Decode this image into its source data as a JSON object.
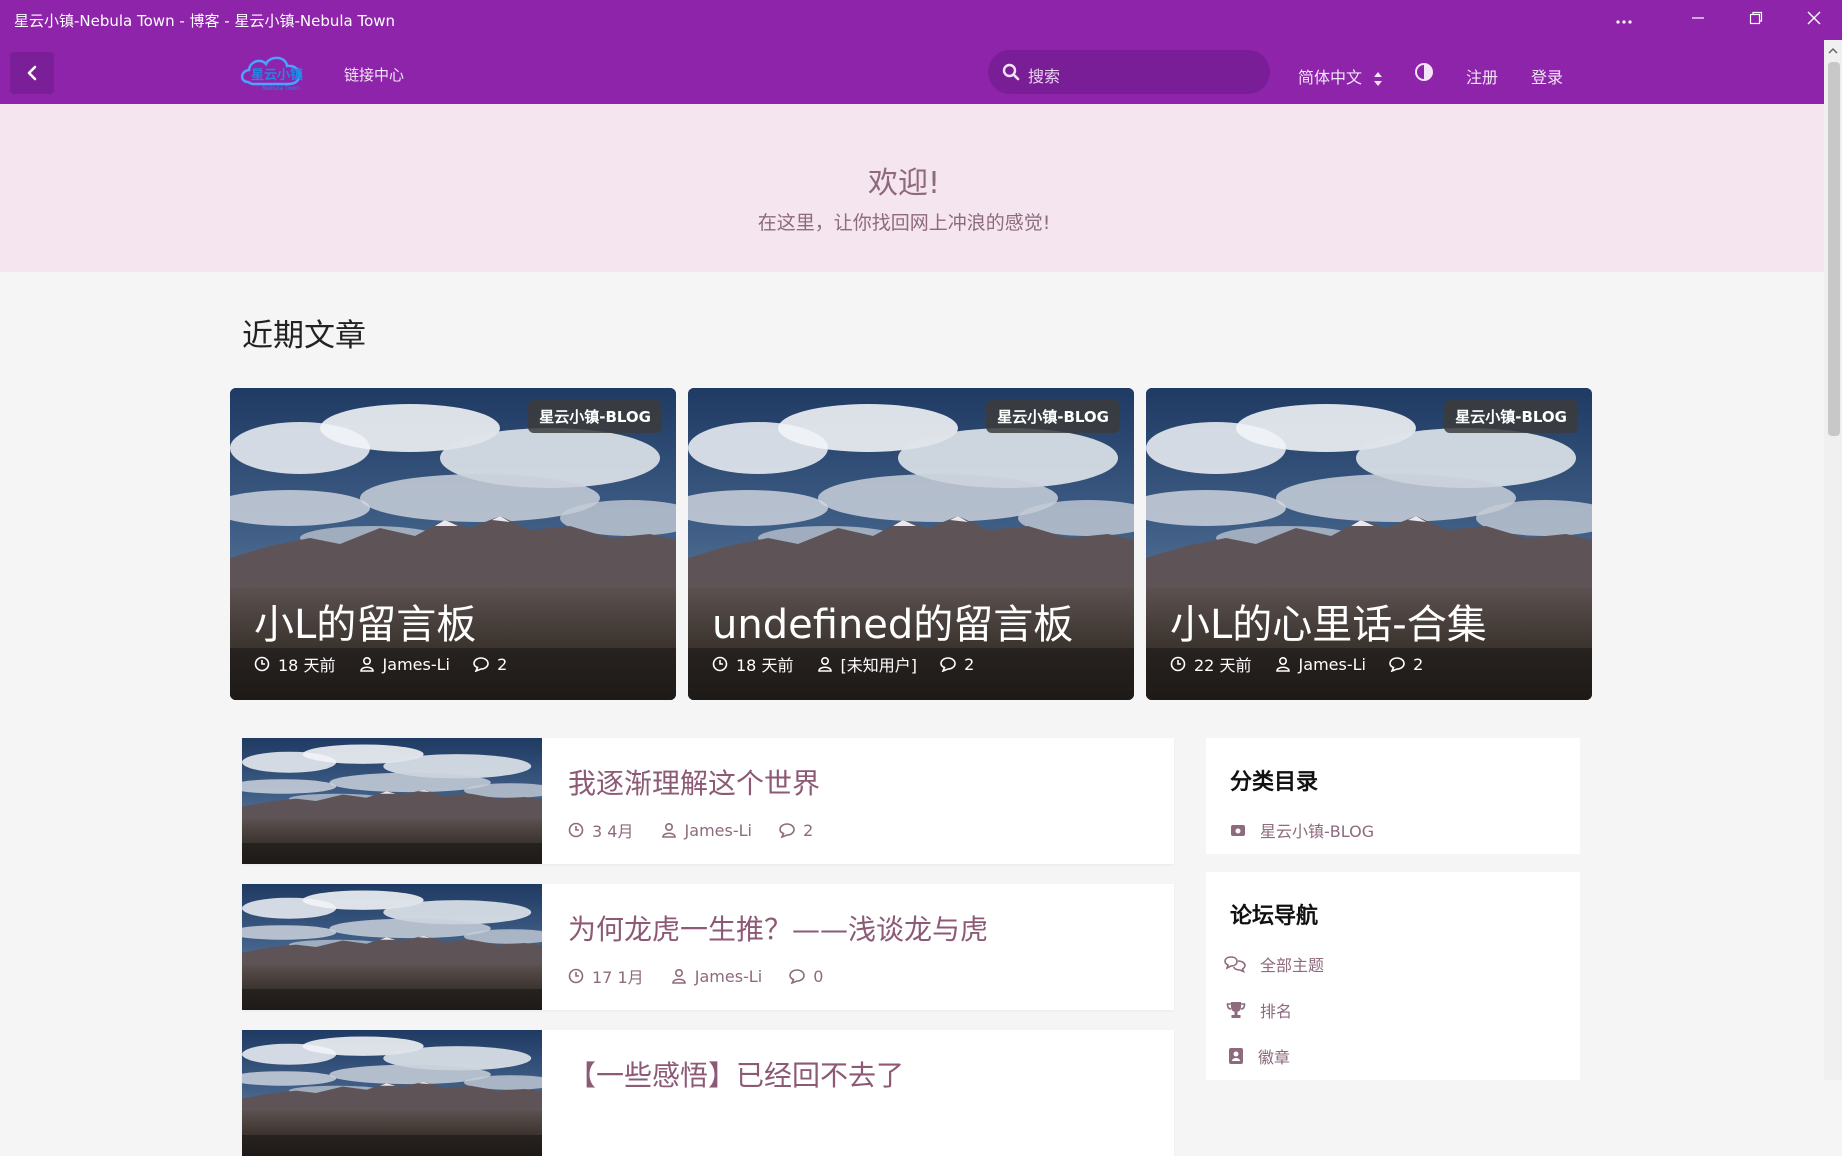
{
  "window": {
    "title": "星云小镇-Nebula Town - 博客 - 星云小镇-Nebula Town"
  },
  "header": {
    "logo_text": "星云小镇",
    "logo_sub": "Nebula Town",
    "nav_link": "链接中心",
    "search_placeholder": "搜索",
    "language": "简体中文",
    "register": "注册",
    "login": "登录"
  },
  "hero": {
    "title": "欢迎!",
    "subtitle": "在这里，让你找回网上冲浪的感觉!"
  },
  "section": {
    "title": "近期文章"
  },
  "featured": [
    {
      "badge": "星云小镇-BLOG",
      "title": "小L的留言板",
      "time": "18 天前",
      "author": "James-Li",
      "comments": "2"
    },
    {
      "badge": "星云小镇-BLOG",
      "title": "undefined的留言板",
      "time": "18 天前",
      "author": "[未知用户]",
      "comments": "2"
    },
    {
      "badge": "星云小镇-BLOG",
      "title": "小L的心里话-合集",
      "time": "22 天前",
      "author": "James-Li",
      "comments": "2"
    }
  ],
  "posts": [
    {
      "title": "我逐渐理解这个世界",
      "time": "3 4月",
      "author": "James-Li",
      "comments": "2"
    },
    {
      "title": "为何龙虎一生推？——浅谈龙与虎",
      "time": "17 1月",
      "author": "James-Li",
      "comments": "0"
    },
    {
      "title": "【一些感悟】已经回不去了",
      "time": "",
      "author": "",
      "comments": ""
    }
  ],
  "sidebar": {
    "categories": {
      "title": "分类目录",
      "items": [
        "星云小镇-BLOG"
      ]
    },
    "forum_nav": {
      "title": "论坛导航",
      "items": [
        "全部主题",
        "排名",
        "徽章"
      ]
    }
  },
  "colors": {
    "primary": "#8e24aa",
    "hero_bg": "#f5e5ee",
    "muted_text": "#8d6a7e"
  }
}
